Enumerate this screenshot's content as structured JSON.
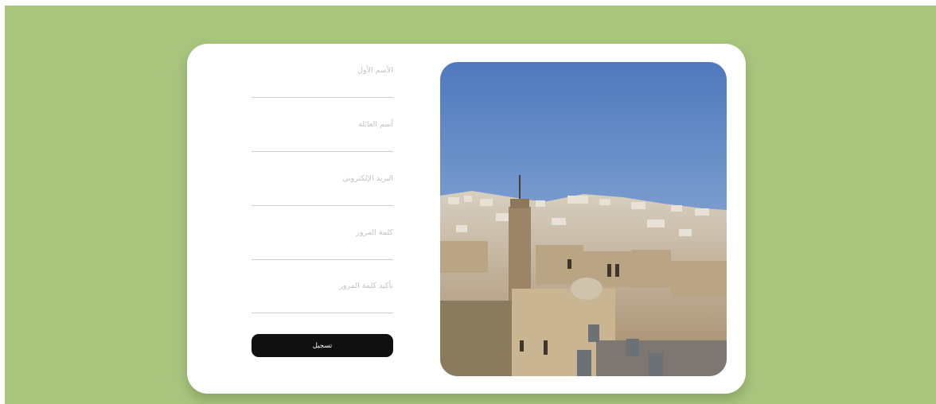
{
  "form": {
    "fields": [
      {
        "label": "الأسم الأول",
        "value": ""
      },
      {
        "label": "أسم العائلة",
        "value": ""
      },
      {
        "label": "البريد الإلكتروني",
        "value": ""
      },
      {
        "label": "كلمة المرور",
        "value": ""
      },
      {
        "label": "تأكيد كلمة المرور",
        "value": ""
      }
    ],
    "submit_label": "تسجيل"
  },
  "photo": {
    "subject": "city-rooftops-photo"
  },
  "colors": {
    "background": "#a9c57d",
    "card": "#ffffff",
    "button": "#111010",
    "button_text": "#ffffff",
    "label": "#c2c2c2",
    "sky": "#5e87c7"
  }
}
